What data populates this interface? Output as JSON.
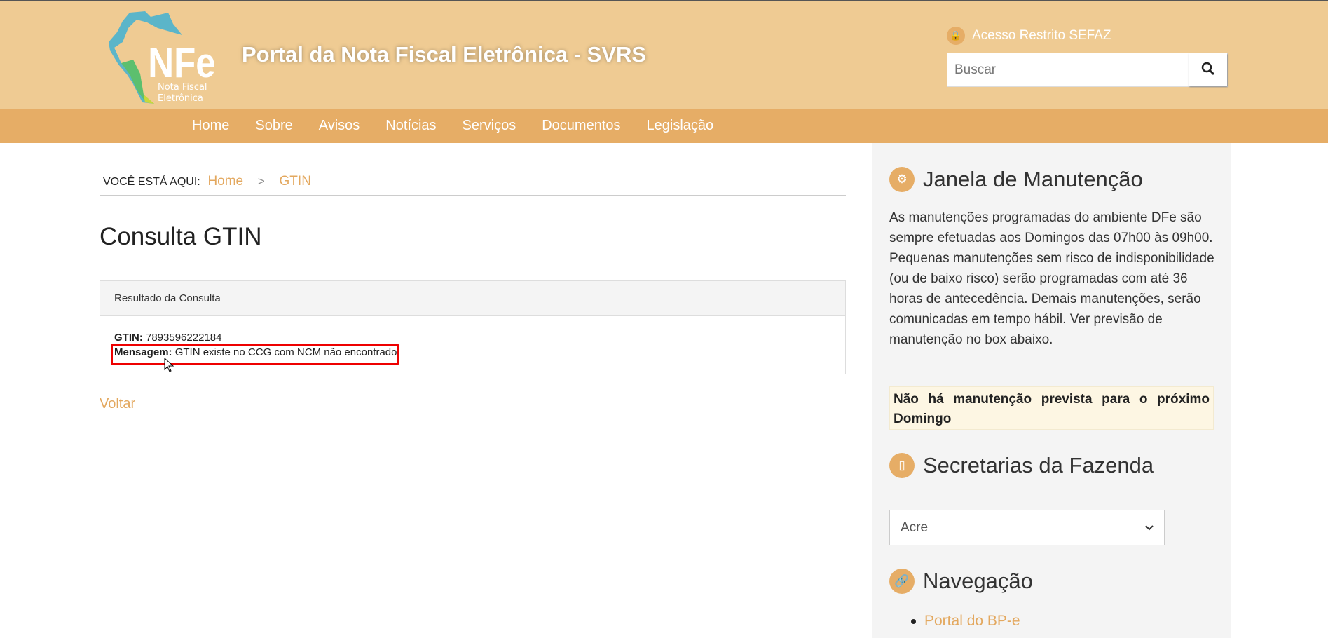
{
  "header": {
    "logo_text": "NFe",
    "logo_subtitle": "Nota Fiscal Eletrônica",
    "site_title": "Portal da Nota Fiscal Eletrônica - SVRS",
    "restricted_access": "Acesso Restrito SEFAZ",
    "search_placeholder": "Buscar"
  },
  "nav": [
    "Home",
    "Sobre",
    "Avisos",
    "Notícias",
    "Serviços",
    "Documentos",
    "Legislação"
  ],
  "breadcrumb": {
    "label": "VOCÊ ESTÁ AQUI:",
    "items": [
      "Home",
      "GTIN"
    ],
    "separator": ">"
  },
  "main": {
    "title": "Consulta GTIN",
    "panel_title": "Resultado da Consulta",
    "gtin_label": "GTIN:",
    "gtin_value": "7893596222184",
    "message_label": "Mensagem:",
    "message_value": "GTIN existe no CCG com NCM não encontrado",
    "back_link": "Voltar"
  },
  "sidebar": {
    "maintenance_title": "Janela de Manutenção",
    "maintenance_text": "As manutenções programadas do ambiente DFe são sempre efetuadas aos Domingos das 07h00 às 09h00. Pequenas manutenções sem risco de indisponibilidade (ou de baixo risco) serão programadas com até 36 horas de antecedência. Demais manutenções, serão comunicadas em tempo hábil. Ver previsão de manutenção no box abaixo.",
    "maintenance_notice": "Não há manutenção prevista para o próximo Domingo",
    "secretarias_title": "Secretarias da Fazenda",
    "state_selected": "Acre",
    "navigation_title": "Navegação",
    "navigation_links": [
      "Portal do BP-e"
    ]
  },
  "colors": {
    "header_bg": "#efcb93",
    "nav_bg": "#e6ad66",
    "link": "#e3a85f",
    "highlight": "#ee0000"
  }
}
